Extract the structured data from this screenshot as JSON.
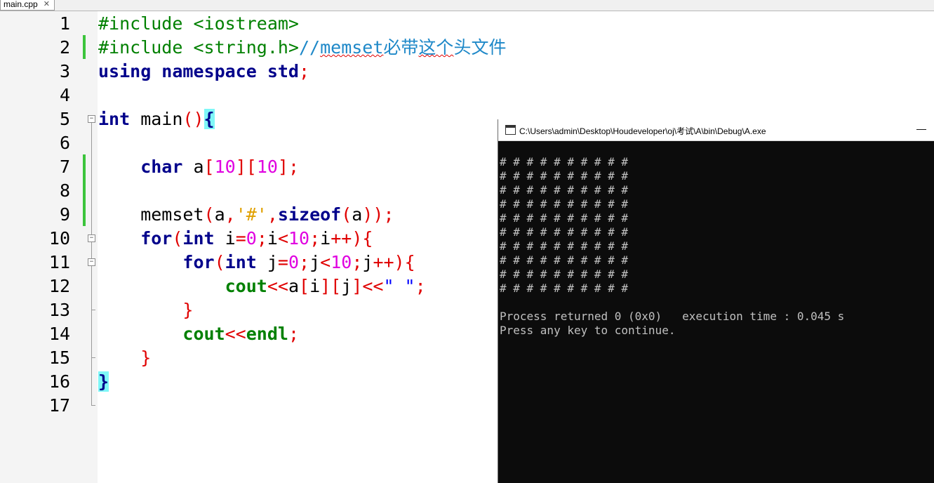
{
  "tab": {
    "label": "main.cpp",
    "close": "✕"
  },
  "line_numbers": [
    "1",
    "2",
    "3",
    "4",
    "5",
    "6",
    "7",
    "8",
    "9",
    "10",
    "11",
    "12",
    "13",
    "14",
    "15",
    "16",
    "17"
  ],
  "code": {
    "l1": "#include <iostream>",
    "l2a": "#include <string.h>",
    "l2b": "//",
    "l2c": "memset",
    "l2d": "必带",
    "l2e": "这个",
    "l2f": "头文件",
    "l3a": "using namespace std",
    "l3b": ";",
    "l5a": "int",
    "l5b": " main",
    "l5c": "()",
    "l5d": "{",
    "l7a": "    char",
    "l7b": " a",
    "l7c": "[",
    "l7d": "10",
    "l7e": "][",
    "l7f": "10",
    "l7g": "];",
    "l9a": "    memset",
    "l9b": "(",
    "l9c": "a",
    "l9d": ",",
    "l9e": "'#'",
    "l9f": ",",
    "l9g": "sizeof",
    "l9h": "(",
    "l9i": "a",
    "l9j": "));",
    "l10a": "    for",
    "l10b": "(",
    "l10c": "int",
    "l10d": " i",
    "l10e": "=",
    "l10f": "0",
    "l10g": ";",
    "l10h": "i",
    "l10i": "<",
    "l10j": "10",
    "l10k": ";",
    "l10l": "i",
    "l10m": "++){",
    "l11a": "        for",
    "l11b": "(",
    "l11c": "int",
    "l11d": " j",
    "l11e": "=",
    "l11f": "0",
    "l11g": ";",
    "l11h": "j",
    "l11i": "<",
    "l11j": "10",
    "l11k": ";",
    "l11l": "j",
    "l11m": "++){",
    "l12a": "            cout",
    "l12b": "<<",
    "l12c": "a",
    "l12d": "[",
    "l12e": "i",
    "l12f": "][",
    "l12g": "j",
    "l12h": "]<<",
    "l12i": "\" \"",
    "l12j": ";",
    "l13": "        }",
    "l14a": "        cout",
    "l14b": "<<",
    "l14c": "endl",
    "l14d": ";",
    "l15": "    }",
    "l16": "}"
  },
  "console": {
    "title": "C:\\Users\\admin\\Desktop\\Houdeveloper\\oj\\考试\\A\\bin\\Debug\\A.exe",
    "minimize": "—",
    "output_rows": [
      "# # # # # # # # # #",
      "# # # # # # # # # #",
      "# # # # # # # # # #",
      "# # # # # # # # # #",
      "# # # # # # # # # #",
      "# # # # # # # # # #",
      "# # # # # # # # # #",
      "# # # # # # # # # #",
      "# # # # # # # # # #",
      "# # # # # # # # # #"
    ],
    "status_line": "Process returned 0 (0x0)   execution time : 0.045 s",
    "prompt_line": "Press any key to continue."
  }
}
